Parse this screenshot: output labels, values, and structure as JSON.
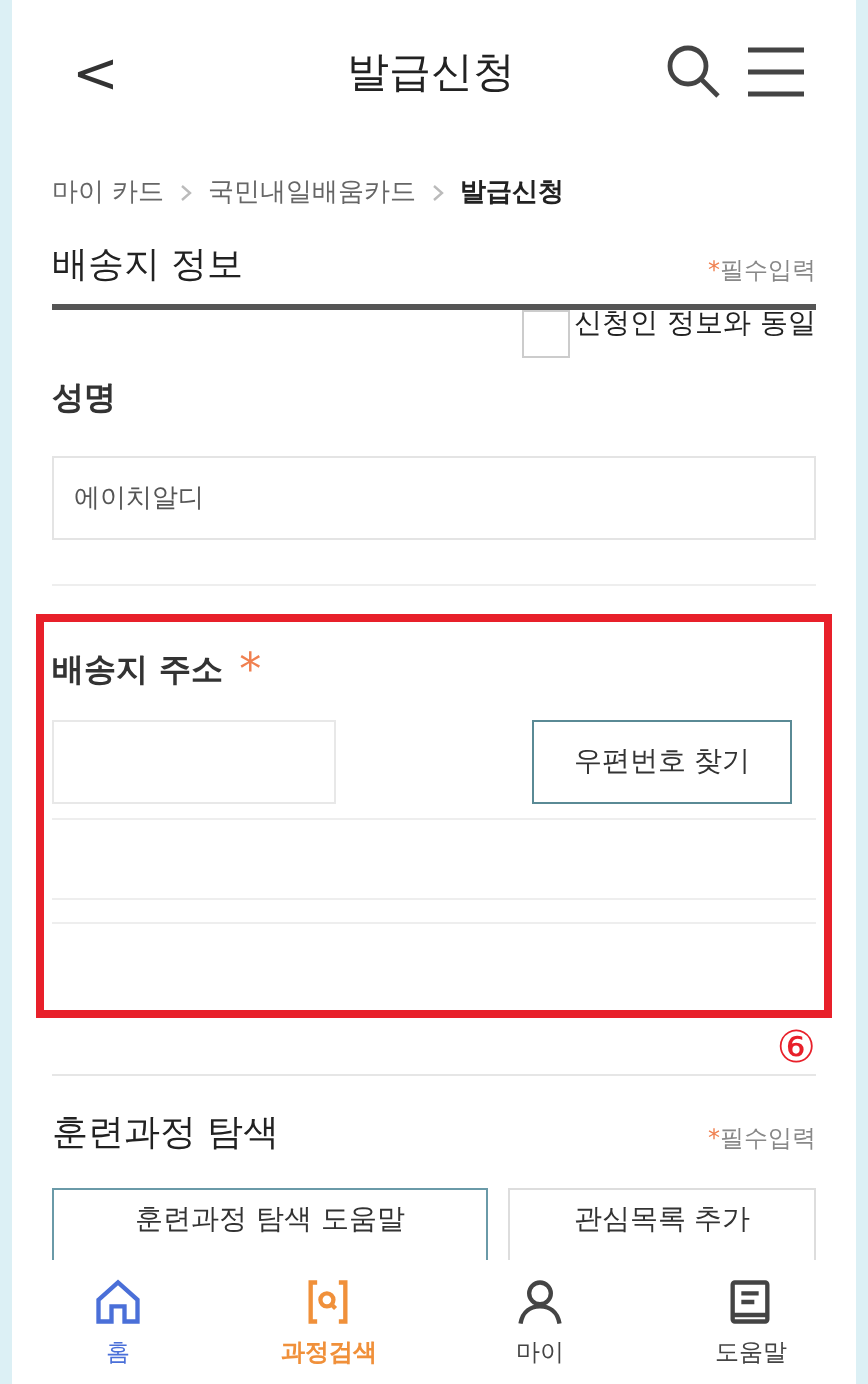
{
  "header": {
    "back": "<",
    "title": "발급신청"
  },
  "breadcrumb": [
    {
      "label": "마이 카드",
      "current": false
    },
    {
      "label": "국민내일배움카드",
      "current": false
    },
    {
      "label": "발급신청",
      "current": true
    }
  ],
  "delivery": {
    "title": "배송지 정보",
    "required_note": "*필수입력",
    "same_as_applicant": {
      "label": "신청인 정보와 동일",
      "checked": false
    },
    "name_label": "성명",
    "name_value": "에이치알디",
    "address_label": "배송지 주소",
    "address_required": "*",
    "postcode_button": "우편번호 찾기",
    "callout": "⑥"
  },
  "course_search": {
    "title": "훈련과정 탐색",
    "required_note": "*필수입력",
    "buttons": [
      {
        "label": "훈련과정 탐색 도움말",
        "kind": "primary"
      },
      {
        "label": "관심목록 추가",
        "kind": "plain"
      }
    ]
  },
  "nav": [
    {
      "label": "홈",
      "selected": false,
      "color": "#4a6fd8"
    },
    {
      "label": "과정검색",
      "selected": true,
      "color": "#f0903a"
    },
    {
      "label": "마이",
      "selected": false,
      "color": "#444444"
    },
    {
      "label": "도움말",
      "selected": false,
      "color": "#444444"
    }
  ]
}
